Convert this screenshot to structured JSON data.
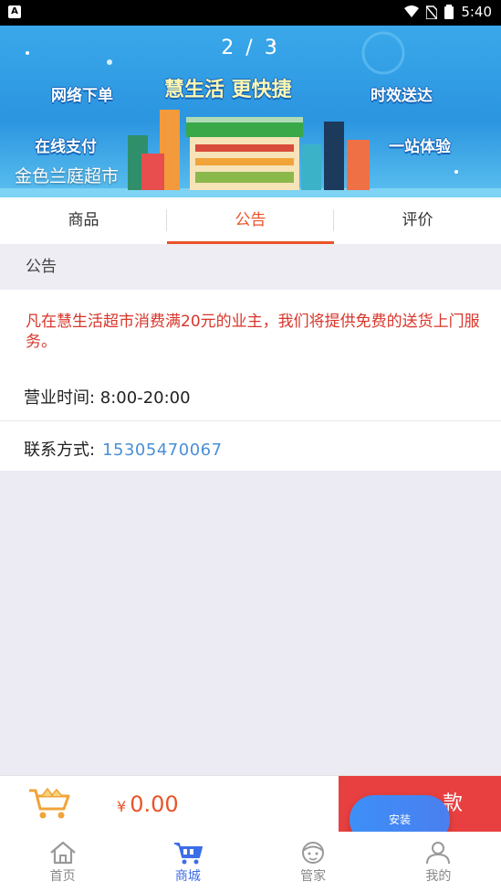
{
  "status_bar": {
    "time": "5:40",
    "app_badge": "A"
  },
  "banner": {
    "counter": "2 / 3",
    "slogans": [
      "网络下单",
      "慧生活 更快捷",
      "时效送达",
      "在线支付",
      "一站体验"
    ],
    "store_name": "金色兰庭超市"
  },
  "tabs": [
    {
      "label": "商品"
    },
    {
      "label": "公告"
    },
    {
      "label": "评价"
    }
  ],
  "active_tab": "公告",
  "section": {
    "title": "公告"
  },
  "notice": {
    "text": "凡在慧生活超市消费满20元的业主，我们将提供免费的送货上门服务。",
    "hours": "营业时间: 8:00-20:00",
    "contact_label": "联系方式:",
    "contact_phone": "15305470067"
  },
  "cart": {
    "currency": "¥",
    "amount": "0.00",
    "checkout_label": "款"
  },
  "install_button": "安装",
  "nav": [
    {
      "label": "首页",
      "icon": "home-icon"
    },
    {
      "label": "商城",
      "icon": "shop-cart-icon"
    },
    {
      "label": "管家",
      "icon": "butler-icon"
    },
    {
      "label": "我的",
      "icon": "user-icon"
    }
  ],
  "colors": {
    "accent": "#e95428",
    "checkout": "#e84040",
    "nav_active": "#3c6ee8",
    "phone": "#4a8fd4"
  }
}
